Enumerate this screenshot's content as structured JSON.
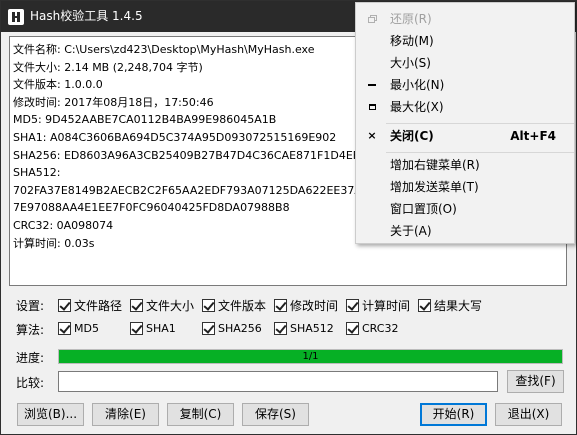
{
  "window": {
    "title": "Hash校验工具 1.4.5"
  },
  "output": {
    "lines": [
      "文件名称: C:\\Users\\zd423\\Desktop\\MyHash\\MyHash.exe",
      "文件大小: 2.14 MB (2,248,704 字节)",
      "文件版本: 1.0.0.0",
      "修改时间: 2017年08月18日，17:50:46",
      "MD5: 9D452AABE7CA0112B4BA99E986045A1B",
      "SHA1: A084C3606BA694D5C374A95D093072515169E902",
      "SHA256: ED8603A96A3CB25409B27B47D4C36CAE871F1D4EFCC6E3C0",
      "SHA512:",
      "702FA37E8149B2AECB2C2F65AA2EDF793A07125DA622EE37AE8FD39",
      "7E97088AA4E1EE7F0FC96040425FD8DA07988B8",
      "CRC32: 0A098074",
      "计算时间: 0.03s"
    ]
  },
  "settings": {
    "label": "设置:",
    "options": [
      "文件路径",
      "文件大小",
      "文件版本",
      "修改时间",
      "计算时间",
      "结果大写"
    ]
  },
  "algorithms": {
    "label": "算法:",
    "options": [
      "MD5",
      "SHA1",
      "SHA256",
      "SHA512",
      "CRC32"
    ]
  },
  "progress": {
    "label": "进度:",
    "text": "1/1",
    "value": 1.0,
    "color": "#06b025"
  },
  "compare": {
    "label": "比较:",
    "value": "",
    "find_button": "查找(F)"
  },
  "buttons": {
    "browse": "浏览(B)...",
    "clear": "清除(E)",
    "copy": "复制(C)",
    "save": "保存(S)",
    "start": "开始(R)",
    "exit": "退出(X)"
  },
  "system_menu": {
    "items": [
      {
        "label": "还原(R)",
        "icon": "restore-icon",
        "disabled": true
      },
      {
        "label": "移动(M)"
      },
      {
        "label": "大小(S)"
      },
      {
        "label": "最小化(N)",
        "icon": "minimize-icon"
      },
      {
        "label": "最大化(X)",
        "icon": "maximize-icon"
      },
      {
        "label": "关闭(C)",
        "icon": "close-icon",
        "shortcut": "Alt+F4",
        "bold": true
      },
      {
        "label": "增加右键菜单(R)"
      },
      {
        "label": "增加发送菜单(T)"
      },
      {
        "label": "窗口置顶(O)"
      },
      {
        "label": "关于(A)"
      }
    ]
  }
}
